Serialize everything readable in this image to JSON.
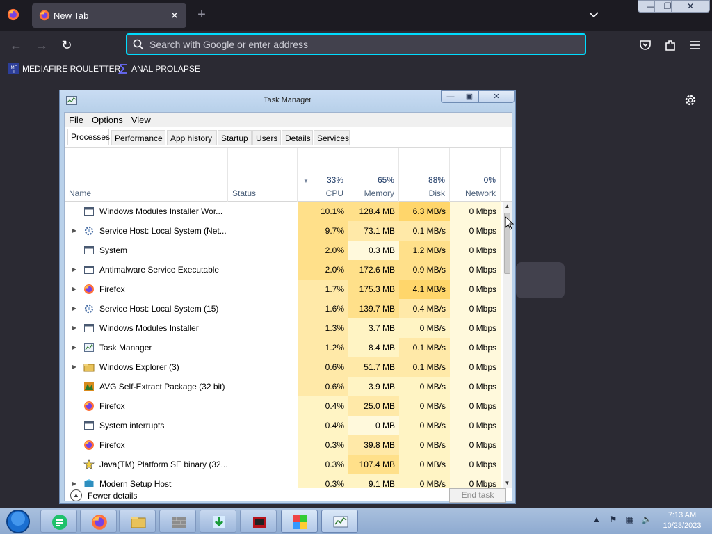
{
  "browser": {
    "tab_title": "New Tab",
    "url_placeholder": "Search with Google or enter address",
    "bookmarks": [
      {
        "label": "MEDIAFIRE ROULETTER",
        "icon": "mediafire-icon"
      },
      {
        "label": "ANAL PROLAPSE",
        "icon": "sigma-icon"
      }
    ]
  },
  "taskmanager": {
    "title": "Task Manager",
    "menu": [
      "File",
      "Options",
      "View"
    ],
    "tabs": [
      "Processes",
      "Performance",
      "App history",
      "Startup",
      "Users",
      "Details",
      "Services"
    ],
    "active_tab": "Processes",
    "columns": {
      "name": "Name",
      "status": "Status",
      "cpu": {
        "pct": "33%",
        "label": "CPU"
      },
      "memory": {
        "pct": "65%",
        "label": "Memory"
      },
      "disk": {
        "pct": "88%",
        "label": "Disk"
      },
      "network": {
        "pct": "0%",
        "label": "Network"
      }
    },
    "processes": [
      {
        "name": "Windows Modules Installer Wor...",
        "expand": false,
        "icon": "window-icon",
        "cpu": "10.1%",
        "memory": "128.4 MB",
        "disk": "6.3 MB/s",
        "network": "0 Mbps"
      },
      {
        "name": "Service Host: Local System (Net...",
        "expand": true,
        "icon": "gear-icon",
        "cpu": "9.7%",
        "memory": "73.1 MB",
        "disk": "0.1 MB/s",
        "network": "0 Mbps"
      },
      {
        "name": "System",
        "expand": false,
        "icon": "window-icon",
        "cpu": "2.0%",
        "memory": "0.3 MB",
        "disk": "1.2 MB/s",
        "network": "0 Mbps"
      },
      {
        "name": "Antimalware Service Executable",
        "expand": true,
        "icon": "window-icon",
        "cpu": "2.0%",
        "memory": "172.6 MB",
        "disk": "0.9 MB/s",
        "network": "0 Mbps"
      },
      {
        "name": "Firefox",
        "expand": true,
        "icon": "firefox-icon",
        "cpu": "1.7%",
        "memory": "175.3 MB",
        "disk": "4.1 MB/s",
        "network": "0 Mbps"
      },
      {
        "name": "Service Host: Local System (15)",
        "expand": true,
        "icon": "gear-icon",
        "cpu": "1.6%",
        "memory": "139.7 MB",
        "disk": "0.4 MB/s",
        "network": "0 Mbps"
      },
      {
        "name": "Windows Modules Installer",
        "expand": true,
        "icon": "window-icon",
        "cpu": "1.3%",
        "memory": "3.7 MB",
        "disk": "0 MB/s",
        "network": "0 Mbps"
      },
      {
        "name": "Task Manager",
        "expand": true,
        "icon": "taskmanager-icon",
        "cpu": "1.2%",
        "memory": "8.4 MB",
        "disk": "0.1 MB/s",
        "network": "0 Mbps"
      },
      {
        "name": "Windows Explorer (3)",
        "expand": true,
        "icon": "folder-icon",
        "cpu": "0.6%",
        "memory": "51.7 MB",
        "disk": "0.1 MB/s",
        "network": "0 Mbps"
      },
      {
        "name": "AVG Self-Extract Package (32 bit)",
        "expand": false,
        "icon": "avg-icon",
        "cpu": "0.6%",
        "memory": "3.9 MB",
        "disk": "0 MB/s",
        "network": "0 Mbps"
      },
      {
        "name": "Firefox",
        "expand": false,
        "icon": "firefox-icon",
        "cpu": "0.4%",
        "memory": "25.0 MB",
        "disk": "0 MB/s",
        "network": "0 Mbps"
      },
      {
        "name": "System interrupts",
        "expand": false,
        "icon": "window-icon",
        "cpu": "0.4%",
        "memory": "0 MB",
        "disk": "0 MB/s",
        "network": "0 Mbps"
      },
      {
        "name": "Firefox",
        "expand": false,
        "icon": "firefox-icon",
        "cpu": "0.3%",
        "memory": "39.8 MB",
        "disk": "0 MB/s",
        "network": "0 Mbps"
      },
      {
        "name": "Java(TM) Platform SE binary (32...",
        "expand": false,
        "icon": "java-icon",
        "cpu": "0.3%",
        "memory": "107.4 MB",
        "disk": "0 MB/s",
        "network": "0 Mbps"
      },
      {
        "name": "Modern Setup Host",
        "expand": true,
        "icon": "setup-icon",
        "cpu": "0.3%",
        "memory": "9.1 MB",
        "disk": "0 MB/s",
        "network": "0 Mbps"
      }
    ],
    "footer": {
      "fewer_details": "Fewer details",
      "end_task": "End task"
    }
  },
  "taskbar": {
    "apps": [
      "sheets-icon",
      "firefox-icon",
      "file-explorer-icon",
      "brick-app-icon",
      "download-app-icon",
      "game-app-icon",
      "colorful-app-icon",
      "taskmanager-icon"
    ],
    "clock_time": "7:13 AM",
    "clock_date": "10/23/2023"
  },
  "colors": {
    "heat_max": "#ffd66b",
    "heat_high": "#ffe08a",
    "heat_mid": "#ffe9a8",
    "heat_low": "#fff4c4",
    "heat_none": "#fff9dc",
    "url_focus": "#00ddff"
  }
}
